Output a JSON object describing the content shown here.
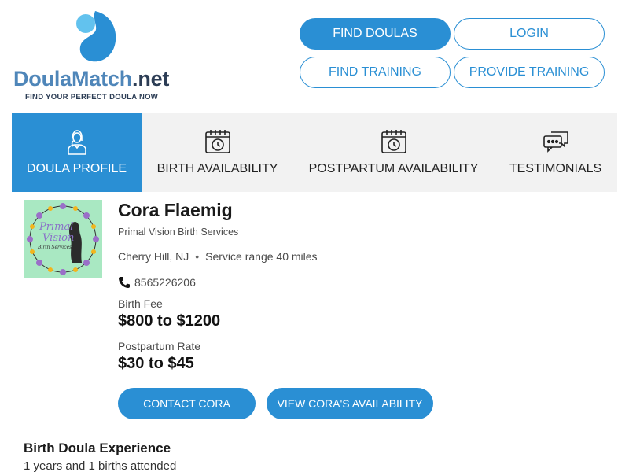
{
  "brand": {
    "logo_part1": "DoulaMatch",
    "logo_part2": ".net",
    "tagline": "FIND YOUR PERFECT DOULA NOW"
  },
  "header_buttons": {
    "find_doulas": "FIND DOULAS",
    "login": "LOGIN",
    "find_training": "FIND TRAINING",
    "provide_training": "PROVIDE TRAINING"
  },
  "tabs": [
    {
      "label": "DOULA PROFILE",
      "icon": "doula-person-icon",
      "active": true
    },
    {
      "label": "BIRTH AVAILABILITY",
      "icon": "calendar-clock-icon",
      "active": false
    },
    {
      "label": "POSTPARTUM AVAILABILITY",
      "icon": "calendar-clock-icon",
      "active": false
    },
    {
      "label": "TESTIMONIALS",
      "icon": "chat-bubbles-icon",
      "active": false
    }
  ],
  "profile": {
    "avatar_text_line1": "Primal",
    "avatar_text_line2": "Vision",
    "avatar_text_line3": "Birth Services",
    "name": "Cora Flaemig",
    "business": "Primal Vision Birth Services",
    "city": "Cherry Hill, NJ",
    "service_range": "Service range 40 miles",
    "phone": "8565226206",
    "birth_fee_label": "Birth Fee",
    "birth_fee": "$800 to $1200",
    "postpartum_label": "Postpartum Rate",
    "postpartum_rate": "$30 to $45",
    "contact_button": "CONTACT CORA",
    "availability_button": "VIEW CORA'S AVAILABILITY"
  },
  "experience": {
    "title": "Birth Doula Experience",
    "text": "1 years and 1 births attended"
  },
  "colors": {
    "accent": "#2a8fd4",
    "tab_background": "#f2f2f2",
    "avatar_background": "#a9e8c2"
  }
}
